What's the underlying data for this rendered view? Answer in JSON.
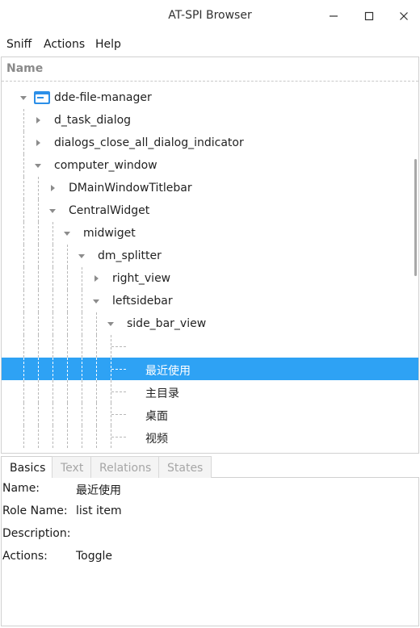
{
  "window": {
    "title": "AT-SPI Browser",
    "minimize_icon": "minimize-icon",
    "maximize_icon": "maximize-icon",
    "close_icon": "close-icon"
  },
  "menu": [
    "Sniff",
    "Actions",
    "Help"
  ],
  "tree": {
    "header": "Name",
    "nodes": [
      {
        "label": "dde-file-manager",
        "depth": 0,
        "state": "expanded",
        "icon": "folder-window-icon"
      },
      {
        "label": "d_task_dialog",
        "depth": 1,
        "state": "collapsed"
      },
      {
        "label": "dialogs_close_all_dialog_indicator",
        "depth": 1,
        "state": "collapsed"
      },
      {
        "label": "computer_window",
        "depth": 1,
        "state": "expanded"
      },
      {
        "label": "DMainWindowTitlebar",
        "depth": 2,
        "state": "collapsed"
      },
      {
        "label": "CentralWidget",
        "depth": 2,
        "state": "expanded"
      },
      {
        "label": "midwiget",
        "depth": 3,
        "state": "expanded"
      },
      {
        "label": "dm_splitter",
        "depth": 4,
        "state": "expanded"
      },
      {
        "label": "right_view",
        "depth": 5,
        "state": "collapsed"
      },
      {
        "label": "leftsidebar",
        "depth": 5,
        "state": "expanded"
      },
      {
        "label": "side_bar_view",
        "depth": 6,
        "state": "expanded"
      },
      {
        "label": "",
        "depth": 7,
        "state": "leaf"
      },
      {
        "label": "最近使用",
        "depth": 7,
        "state": "leaf",
        "selected": true
      },
      {
        "label": "主目录",
        "depth": 7,
        "state": "leaf"
      },
      {
        "label": "桌面",
        "depth": 7,
        "state": "leaf"
      },
      {
        "label": "视频",
        "depth": 7,
        "state": "leaf"
      }
    ]
  },
  "tabs": [
    {
      "label": "Basics",
      "active": true
    },
    {
      "label": "Text",
      "active": false
    },
    {
      "label": "Relations",
      "active": false
    },
    {
      "label": "States",
      "active": false
    }
  ],
  "details": [
    {
      "key": "Name:",
      "value": "最近使用"
    },
    {
      "key": "Role Name:",
      "value": "list item"
    },
    {
      "key": "Description:",
      "value": ""
    },
    {
      "key": "Actions:",
      "value": "Toggle"
    }
  ],
  "colors": {
    "selection": "#2ea2f4",
    "folder_icon": "#2c8fe8"
  }
}
